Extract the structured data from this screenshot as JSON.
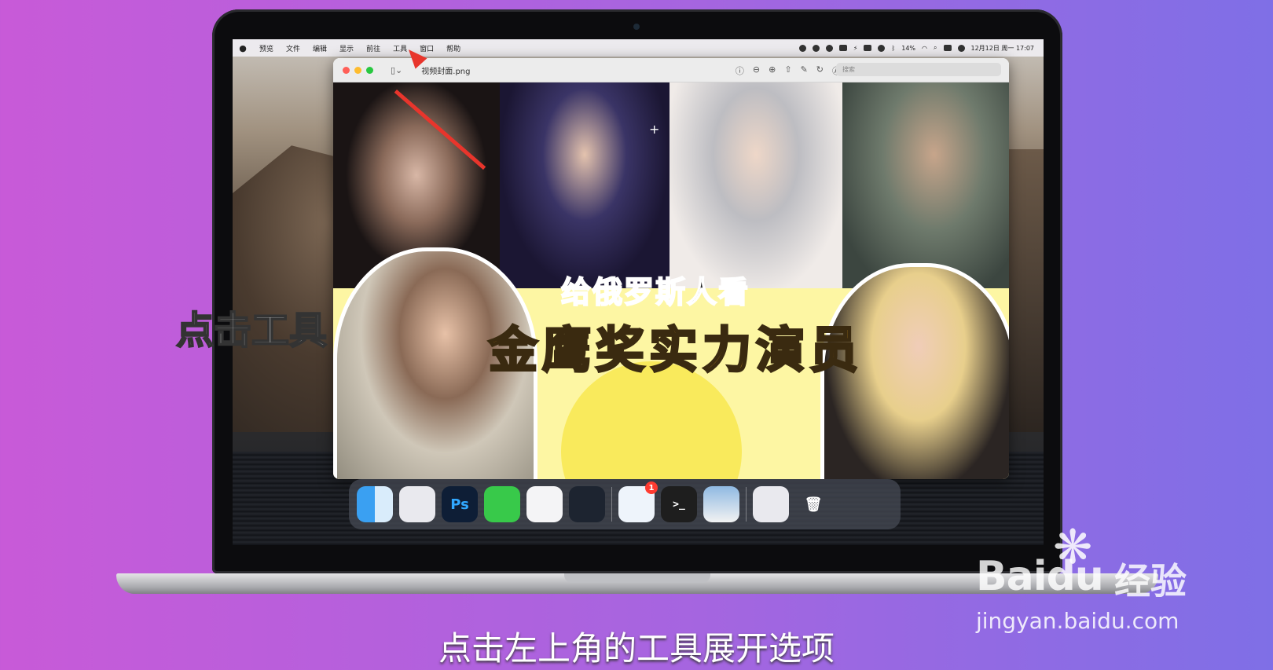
{
  "menubar": {
    "items": [
      "预览",
      "文件",
      "编辑",
      "显示",
      "前往",
      "工具",
      "窗口",
      "帮助"
    ],
    "battery": "14%",
    "datetime": "12月12日 周一 17:07"
  },
  "window": {
    "title": "视频封面.png",
    "search_placeholder": "搜索"
  },
  "image": {
    "headline1": "给俄罗斯人看",
    "headline2": "金鹰奖实力演员"
  },
  "dock": {
    "ps_label": "Ps",
    "mail_badge": "1",
    "terminal_label": ">_"
  },
  "overlay": {
    "side_caption": "点击工具",
    "subtitle": "点击左上角的工具展开选项"
  },
  "watermark": {
    "brand_bai": "Bai",
    "brand_du": "du",
    "brand_jy": "经验",
    "url": "jingyan.baidu.com"
  },
  "colors": {
    "background_left": "#c85ad8",
    "background_right": "#7f6fe6",
    "arrow": "#e8352c",
    "headline2": "#ffb51f",
    "canvas_bg": "#fdf6a3"
  }
}
